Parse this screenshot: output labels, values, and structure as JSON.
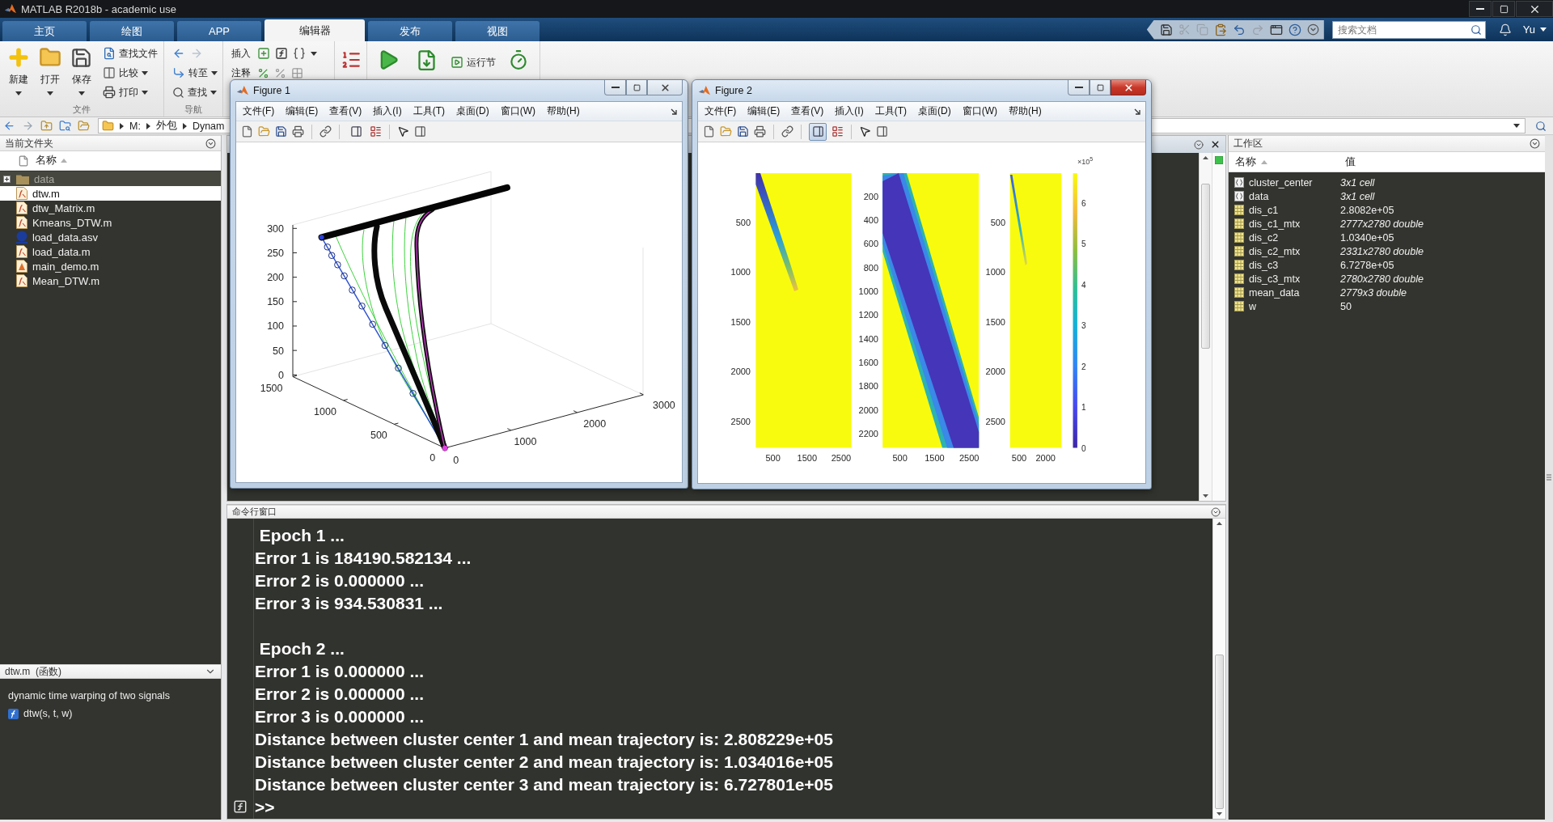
{
  "window": {
    "title": "MATLAB R2018b - academic use"
  },
  "ribbon_tabs": [
    {
      "label": "主页",
      "selected": false
    },
    {
      "label": "绘图",
      "selected": false
    },
    {
      "label": "APP",
      "selected": false
    },
    {
      "label": "编辑器",
      "selected": true
    },
    {
      "label": "发布",
      "selected": false
    },
    {
      "label": "视图",
      "selected": false
    }
  ],
  "search": {
    "placeholder": "搜索文档"
  },
  "user": {
    "name": "Yu"
  },
  "ribbon": {
    "file_group": {
      "label": "文件",
      "large_buttons": [
        {
          "label": "新建",
          "dropdown": true
        },
        {
          "label": "打开",
          "dropdown": true
        },
        {
          "label": "保存",
          "dropdown": true
        }
      ],
      "small_buttons": [
        {
          "label": "查找文件",
          "dropdown": false
        },
        {
          "label": "比较",
          "dropdown": true
        },
        {
          "label": "打印",
          "dropdown": true
        }
      ]
    },
    "navigate_group": {
      "label": "导航",
      "small_buttons": [
        {
          "label": "转至",
          "dropdown": true
        },
        {
          "label": "查找",
          "dropdown": true
        }
      ]
    },
    "edit_group": {
      "rows": [
        {
          "label": "插入"
        },
        {
          "label": "注释"
        }
      ]
    },
    "run_group": {
      "section_button": {
        "label": "运行节"
      }
    }
  },
  "address_bar": {
    "path": [
      "M:",
      "外包",
      "Dynam"
    ]
  },
  "current_folder": {
    "title": "当前文件夹",
    "column": "名称",
    "files": [
      {
        "name": "data",
        "kind": "folder",
        "selected": false,
        "expanded": false
      },
      {
        "name": "dtw.m",
        "kind": "function",
        "selected": true
      },
      {
        "name": "dtw_Matrix.m",
        "kind": "function",
        "selected": false
      },
      {
        "name": "Kmeans_DTW.m",
        "kind": "function",
        "selected": false
      },
      {
        "name": "load_data.asv",
        "kind": "autosave",
        "selected": false
      },
      {
        "name": "load_data.m",
        "kind": "function",
        "selected": false
      },
      {
        "name": "main_demo.m",
        "kind": "script",
        "selected": false
      },
      {
        "name": "Mean_DTW.m",
        "kind": "function",
        "selected": false
      }
    ]
  },
  "details": {
    "title": "dtw.m  (函数)",
    "description": "dynamic time warping of two signals",
    "signature": "dtw(s, t, w)"
  },
  "command_window": {
    "title": "命令行窗口",
    "output": [
      [
        " Epoch 1 ...",
        "Error 1 is 184190.582134 ...",
        "Error 2 is 0.000000 ...",
        "Error 3 is 934.530831 ..."
      ],
      [
        " Epoch 2 ...",
        "Error 1 is 0.000000 ...",
        "Error 2 is 0.000000 ...",
        "Error 3 is 0.000000 ...",
        "Distance between cluster center 1 and mean trajectory is: 2.808229e+05",
        "Distance between cluster center 2 and mean trajectory is: 1.034016e+05",
        "Distance between cluster center 3 and mean trajectory is: 6.727801e+05"
      ]
    ],
    "prompt": ">>"
  },
  "workspace": {
    "title": "工作区",
    "columns": [
      "名称",
      "值"
    ],
    "variables": [
      {
        "name": "cluster_center",
        "value": "3x1 cell",
        "kind": "cell"
      },
      {
        "name": "data",
        "value": "3x1 cell",
        "kind": "cell"
      },
      {
        "name": "dis_c1",
        "value": "2.8082e+05",
        "kind": "scalar"
      },
      {
        "name": "dis_c1_mtx",
        "value": "2777x2780 double",
        "kind": "array"
      },
      {
        "name": "dis_c2",
        "value": "1.0340e+05",
        "kind": "scalar"
      },
      {
        "name": "dis_c2_mtx",
        "value": "2331x2780 double",
        "kind": "array"
      },
      {
        "name": "dis_c3",
        "value": "6.7278e+05",
        "kind": "scalar"
      },
      {
        "name": "dis_c3_mtx",
        "value": "2780x2780 double",
        "kind": "array"
      },
      {
        "name": "mean_data",
        "value": "2779x3 double",
        "kind": "array"
      },
      {
        "name": "w",
        "value": "50",
        "kind": "scalar"
      }
    ]
  },
  "figures": [
    {
      "title": "Figure 1",
      "active": false,
      "menus": [
        "文件(F)",
        "编辑(E)",
        "查看(V)",
        "插入(I)",
        "工具(T)",
        "桌面(D)",
        "窗口(W)",
        "帮助(H)"
      ],
      "plot_tools_pressed": false,
      "plot": {
        "kind": "trajectories_3d",
        "z_ticks": [
          "300",
          "250",
          "200",
          "150",
          "100",
          "50",
          "0"
        ],
        "y_ticks": [
          "1500",
          "1000",
          "500",
          "0"
        ],
        "x_ticks": [
          "0",
          "1000",
          "2000",
          "3000"
        ]
      }
    },
    {
      "title": "Figure 2",
      "active": true,
      "menus": [
        "文件(F)",
        "编辑(E)",
        "查看(V)",
        "插入(I)",
        "工具(T)",
        "桌面(D)",
        "窗口(W)",
        "帮助(H)"
      ],
      "plot_tools_pressed": true,
      "plot": {
        "kind": "heatmaps",
        "panels": [
          {
            "y_ticks": [
              "500",
              "1000",
              "1500",
              "2000",
              "2500"
            ],
            "x_ticks": [
              "500",
              "1500",
              "2500"
            ]
          },
          {
            "y_ticks": [
              "200",
              "400",
              "600",
              "800",
              "1000",
              "1200",
              "1400",
              "1600",
              "1800",
              "2000",
              "2200"
            ],
            "x_ticks": [
              "500",
              "1500",
              "2500"
            ]
          },
          {
            "y_ticks": [
              "500",
              "1000",
              "1500",
              "2000",
              "2500"
            ],
            "x_ticks": [
              "500",
              "2000"
            ]
          }
        ],
        "colorbar": {
          "exponent": "×10$^{5}$",
          "ticks": [
            "6",
            "5",
            "4",
            "3",
            "2",
            "1",
            "0"
          ]
        }
      }
    }
  ]
}
